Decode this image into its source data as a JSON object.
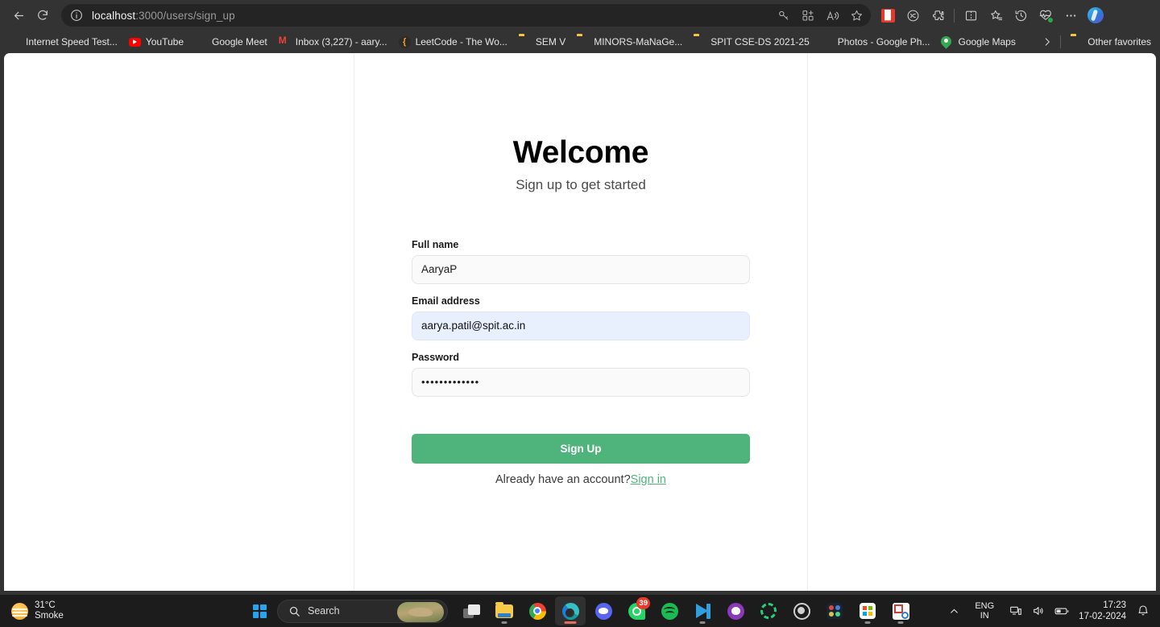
{
  "browser": {
    "nav": {
      "back_label": "Back",
      "refresh_label": "Refresh"
    },
    "address": {
      "info_icon": "info-circle-icon",
      "url_host": "localhost",
      "url_path": ":3000/users/sign_up",
      "actions": [
        {
          "name": "password-key-icon",
          "glyph": "key"
        },
        {
          "name": "collections-icon",
          "glyph": "collections"
        },
        {
          "name": "read-aloud-icon",
          "glyph": "read-aloud"
        },
        {
          "name": "add-favorite-icon",
          "glyph": "star"
        }
      ]
    },
    "toolbar_icons": [
      {
        "name": "extension-adblock-icon",
        "glyph": "extension"
      },
      {
        "name": "browser-essentials-icon",
        "glyph": "essentials"
      },
      {
        "name": "extensions-puzzle-icon",
        "glyph": "puzzle"
      },
      {
        "name": "split-screen-icon",
        "glyph": "split"
      },
      {
        "name": "favorites-icon",
        "glyph": "favorites"
      },
      {
        "name": "history-icon",
        "glyph": "history"
      },
      {
        "name": "performance-icon",
        "glyph": "performance"
      },
      {
        "name": "settings-more-icon",
        "glyph": "ellipsis"
      },
      {
        "name": "copilot-icon",
        "glyph": "copilot"
      }
    ],
    "bookmarks": [
      {
        "label": "Internet Speed Test...",
        "icon": "speedtest-icon"
      },
      {
        "label": "YouTube",
        "icon": "youtube-icon"
      },
      {
        "label": "Google Meet",
        "icon": "google-meet-icon"
      },
      {
        "label": "Inbox (3,227) - aary...",
        "icon": "gmail-icon"
      },
      {
        "label": "LeetCode - The Wo...",
        "icon": "leetcode-icon"
      },
      {
        "label": "SEM V",
        "icon": "folder-icon"
      },
      {
        "label": "MINORS-MaNaGe...",
        "icon": "folder-icon"
      },
      {
        "label": "SPIT CSE-DS 2021-25",
        "icon": "folder-icon"
      },
      {
        "label": "Photos - Google Ph...",
        "icon": "google-photos-icon"
      },
      {
        "label": "Google Maps",
        "icon": "google-maps-icon"
      }
    ],
    "bookmarks_overflow": {
      "chevron": "chevron-right-icon",
      "other_favorites_label": "Other favorites",
      "other_favorites_icon": "folder-icon"
    }
  },
  "page": {
    "heading": "Welcome",
    "subtitle": "Sign up to get started",
    "fields": [
      {
        "label": "Full name",
        "value": "AaryaP",
        "placeholder": "Full name",
        "name": "full-name",
        "autofilled": false
      },
      {
        "label": "Email address",
        "value": "aarya.patil@spit.ac.in",
        "placeholder": "Email address",
        "name": "email-address",
        "autofilled": true
      },
      {
        "label": "Password",
        "value": "•••••••••••••",
        "placeholder": "Password",
        "name": "password",
        "autofilled": false
      }
    ],
    "submit_label": "Sign Up",
    "footer_text": "Already have an account?",
    "footer_link": "Sign in",
    "accent_color": "#4fb37c",
    "autofill_color": "#e8f0fe"
  },
  "taskbar": {
    "weather": {
      "temperature": "31°C",
      "condition": "Smoke",
      "icon": "smoke-sun-icon"
    },
    "start": {
      "name": "start-button",
      "icon": "windows-logo-icon"
    },
    "search": {
      "placeholder": "Search",
      "icon": "search-icon"
    },
    "apps": [
      {
        "name": "task-view",
        "icon": "task-view-icon",
        "running": false,
        "active": false,
        "badge": ""
      },
      {
        "name": "file-explorer",
        "icon": "file-explorer-icon",
        "running": false,
        "active": false,
        "badge": ""
      },
      {
        "name": "google-chrome",
        "icon": "chrome-icon",
        "running": false,
        "active": false,
        "badge": ""
      },
      {
        "name": "microsoft-edge",
        "icon": "edge-icon",
        "running": true,
        "active": true,
        "badge": ""
      },
      {
        "name": "discord",
        "icon": "discord-icon",
        "running": false,
        "active": false,
        "badge": ""
      },
      {
        "name": "whatsapp",
        "icon": "whatsapp-icon",
        "running": false,
        "active": false,
        "badge": "39"
      },
      {
        "name": "spotify",
        "icon": "spotify-icon",
        "running": false,
        "active": false,
        "badge": ""
      },
      {
        "name": "visual-studio-code",
        "icon": "vscode-icon",
        "running": true,
        "active": false,
        "badge": ""
      },
      {
        "name": "github-desktop",
        "icon": "github-icon",
        "running": false,
        "active": false,
        "badge": ""
      },
      {
        "name": "loading-ring-app",
        "icon": "ring-icon",
        "running": false,
        "active": false,
        "badge": ""
      },
      {
        "name": "obs-studio",
        "icon": "obs-icon",
        "running": false,
        "active": false,
        "badge": ""
      },
      {
        "name": "davinci-resolve",
        "icon": "resolve-icon",
        "running": false,
        "active": false,
        "badge": ""
      },
      {
        "name": "microsoft-store",
        "icon": "store-icon",
        "running": true,
        "active": false,
        "badge": ""
      },
      {
        "name": "snipping-tool",
        "icon": "snipping-tool-icon",
        "running": true,
        "active": false,
        "badge": ""
      }
    ],
    "tray": {
      "overflow_icon": "chevron-up-icon",
      "language_line1": "ENG",
      "language_line2": "IN",
      "network_icon": "network-icon",
      "volume_icon": "volume-icon",
      "battery_icon": "battery-icon",
      "time": "17:23",
      "date": "17-02-2024",
      "notifications_icon": "notification-bell-icon"
    }
  }
}
